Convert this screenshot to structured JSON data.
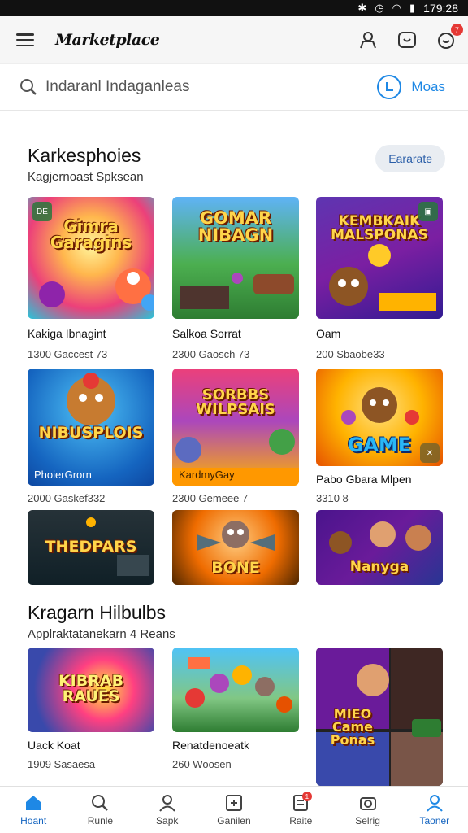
{
  "status_bar": {
    "time": "179:28"
  },
  "app_bar": {
    "brand": "Marketplace",
    "notification_count": "7"
  },
  "search": {
    "placeholder": "Indaranl Indaganleas",
    "more_label": "Moas"
  },
  "section1": {
    "title": "Karkesphoies",
    "subtitle": "Kagjernoast Spksean",
    "pill_label": "Eararate",
    "cards": [
      {
        "art": "Gimra Garagins",
        "title": "Kakiga Ibnagint",
        "meta": "1300 Gaccest 73"
      },
      {
        "art": "GOMAR NIBAGN",
        "title": "Salkoa Sorrat",
        "meta": "2300 Gaosch 73"
      },
      {
        "art": "KEMBKAIK MALSPONAS",
        "title": "Oam",
        "meta": "200 Sbaobe33"
      },
      {
        "art": "NIBUSPLOIS",
        "caption": "PhoierGrorn",
        "title": "",
        "meta": "2000 Gaskef332"
      },
      {
        "art": "SORBBS WILPSAIS",
        "caption": "KardmyGay",
        "title": "",
        "meta": "2300 Gemeee 7"
      },
      {
        "art": "GAME",
        "title": "Pabo Gbara Mlpen",
        "meta": "3310 8"
      },
      {
        "art": "THEDPARS"
      },
      {
        "art": "BONE"
      },
      {
        "art": "Nanyga"
      }
    ]
  },
  "section2": {
    "title": "Kragarn Hilbulbs",
    "subtitle": "Applraktatanekarn 4 Reans",
    "cards": [
      {
        "art": "KIBRAB RAUES",
        "title": "Uack Koat",
        "meta": "1909 Sasaesa"
      },
      {
        "art": "",
        "title": "Renatdenoeatk",
        "meta": "260 Woosen"
      },
      {
        "art": "MIEO Came Ponas"
      }
    ]
  },
  "bottom_nav": [
    {
      "label": "Hoant",
      "icon": "home-icon",
      "active": true
    },
    {
      "label": "Runle",
      "icon": "search-icon"
    },
    {
      "label": "Sapk",
      "icon": "user-icon"
    },
    {
      "label": "Ganilen",
      "icon": "games-icon"
    },
    {
      "label": "Raite",
      "icon": "cart-icon",
      "badge": "1"
    },
    {
      "label": "Selrig",
      "icon": "camera-icon"
    },
    {
      "label": "Taoner",
      "icon": "profile-icon"
    }
  ],
  "colors": {
    "accent": "#1e88e5",
    "badge": "#e53935"
  }
}
